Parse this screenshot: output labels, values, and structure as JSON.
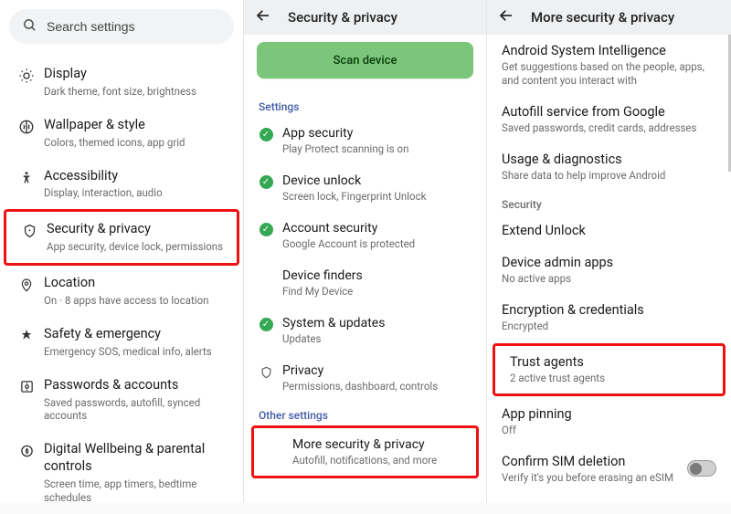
{
  "left": {
    "search_placeholder": "Search settings",
    "items": [
      {
        "label": "Display",
        "sub": "Dark theme, font size, brightness"
      },
      {
        "label": "Wallpaper & style",
        "sub": "Colors, themed icons, app grid"
      },
      {
        "label": "Accessibility",
        "sub": "Display, interaction, audio"
      },
      {
        "label": "Security & privacy",
        "sub": "App security, device lock, permissions"
      },
      {
        "label": "Location",
        "sub": "On · 8 apps have access to location"
      },
      {
        "label": "Safety & emergency",
        "sub": "Emergency SOS, medical info, alerts"
      },
      {
        "label": "Passwords & accounts",
        "sub": "Saved passwords, autofill, synced accounts"
      },
      {
        "label": "Digital Wellbeing & parental controls",
        "sub": "Screen time, app timers, bedtime schedules"
      }
    ],
    "highlight_index": 3
  },
  "mid": {
    "title": "Security & privacy",
    "scan_label": "Scan device",
    "section_settings": "Settings",
    "section_other": "Other settings",
    "rows": [
      {
        "label": "App security",
        "sub": "Play Protect scanning is on",
        "status": "ok"
      },
      {
        "label": "Device unlock",
        "sub": "Screen lock, Fingerprint Unlock",
        "status": "ok"
      },
      {
        "label": "Account security",
        "sub": "Google Account is protected",
        "status": "ok"
      },
      {
        "label": "Device finders",
        "sub": "Find My Device",
        "status": "none"
      },
      {
        "label": "System & updates",
        "sub": "Updates",
        "status": "ok"
      },
      {
        "label": "Privacy",
        "sub": "Permissions, dashboard, controls",
        "status": "shield"
      }
    ],
    "more": {
      "label": "More security & privacy",
      "sub": "Autofill, notifications, and more"
    }
  },
  "right": {
    "title": "More security & privacy",
    "rows_top": [
      {
        "label": "Android System Intelligence",
        "sub": "Get suggestions based on the people, apps, and content you interact with"
      },
      {
        "label": "Autofill service from Google",
        "sub": "Saved passwords, credit cards, addresses"
      },
      {
        "label": "Usage & diagnostics",
        "sub": "Share data to help improve Android"
      }
    ],
    "section_security": "Security",
    "rows_sec": [
      {
        "label": "Extend Unlock",
        "sub": ""
      },
      {
        "label": "Device admin apps",
        "sub": "No active apps"
      },
      {
        "label": "Encryption & credentials",
        "sub": "Encrypted"
      },
      {
        "label": "Trust agents",
        "sub": "2 active trust agents"
      },
      {
        "label": "App pinning",
        "sub": "Off"
      },
      {
        "label": "Confirm SIM deletion",
        "sub": "Verify it's you before erasing an eSIM"
      }
    ],
    "highlight_index": 3
  }
}
